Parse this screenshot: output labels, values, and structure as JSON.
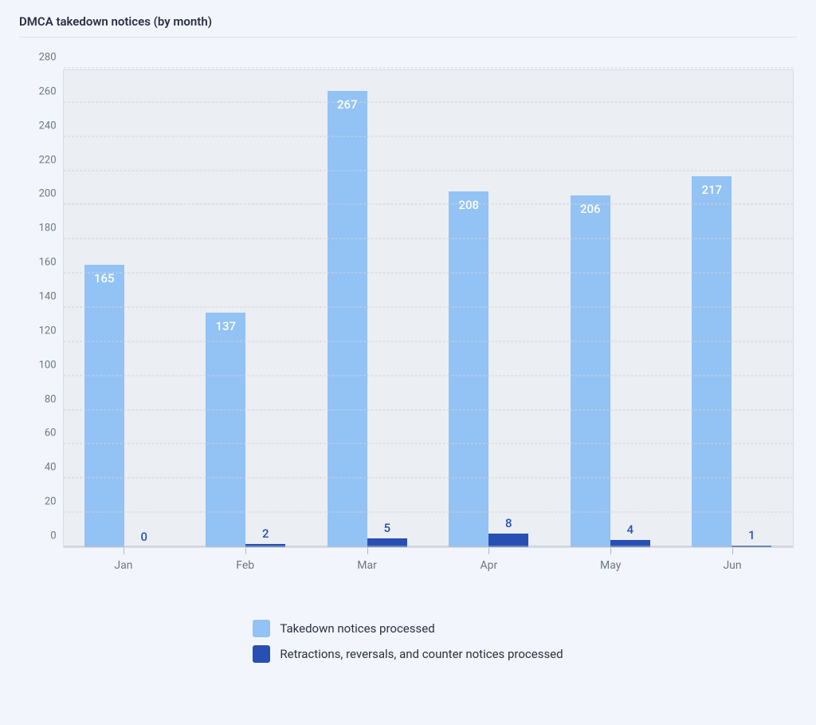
{
  "chart_data": {
    "type": "bar",
    "title": "DMCA takedown notices (by month)",
    "categories": [
      "Jan",
      "Feb",
      "Mar",
      "Apr",
      "May",
      "Jun"
    ],
    "series": [
      {
        "name": "Takedown notices processed",
        "values": [
          165,
          137,
          267,
          208,
          206,
          217
        ],
        "color": "#93c2f4"
      },
      {
        "name": "Retractions, reversals, and counter notices processed",
        "values": [
          0,
          2,
          5,
          8,
          4,
          1
        ],
        "color": "#2850b4"
      }
    ],
    "ylim": [
      0,
      280
    ],
    "y_ticks": [
      0,
      20,
      40,
      60,
      80,
      100,
      120,
      140,
      160,
      180,
      200,
      220,
      240,
      260,
      280
    ],
    "xlabel": "",
    "ylabel": ""
  }
}
